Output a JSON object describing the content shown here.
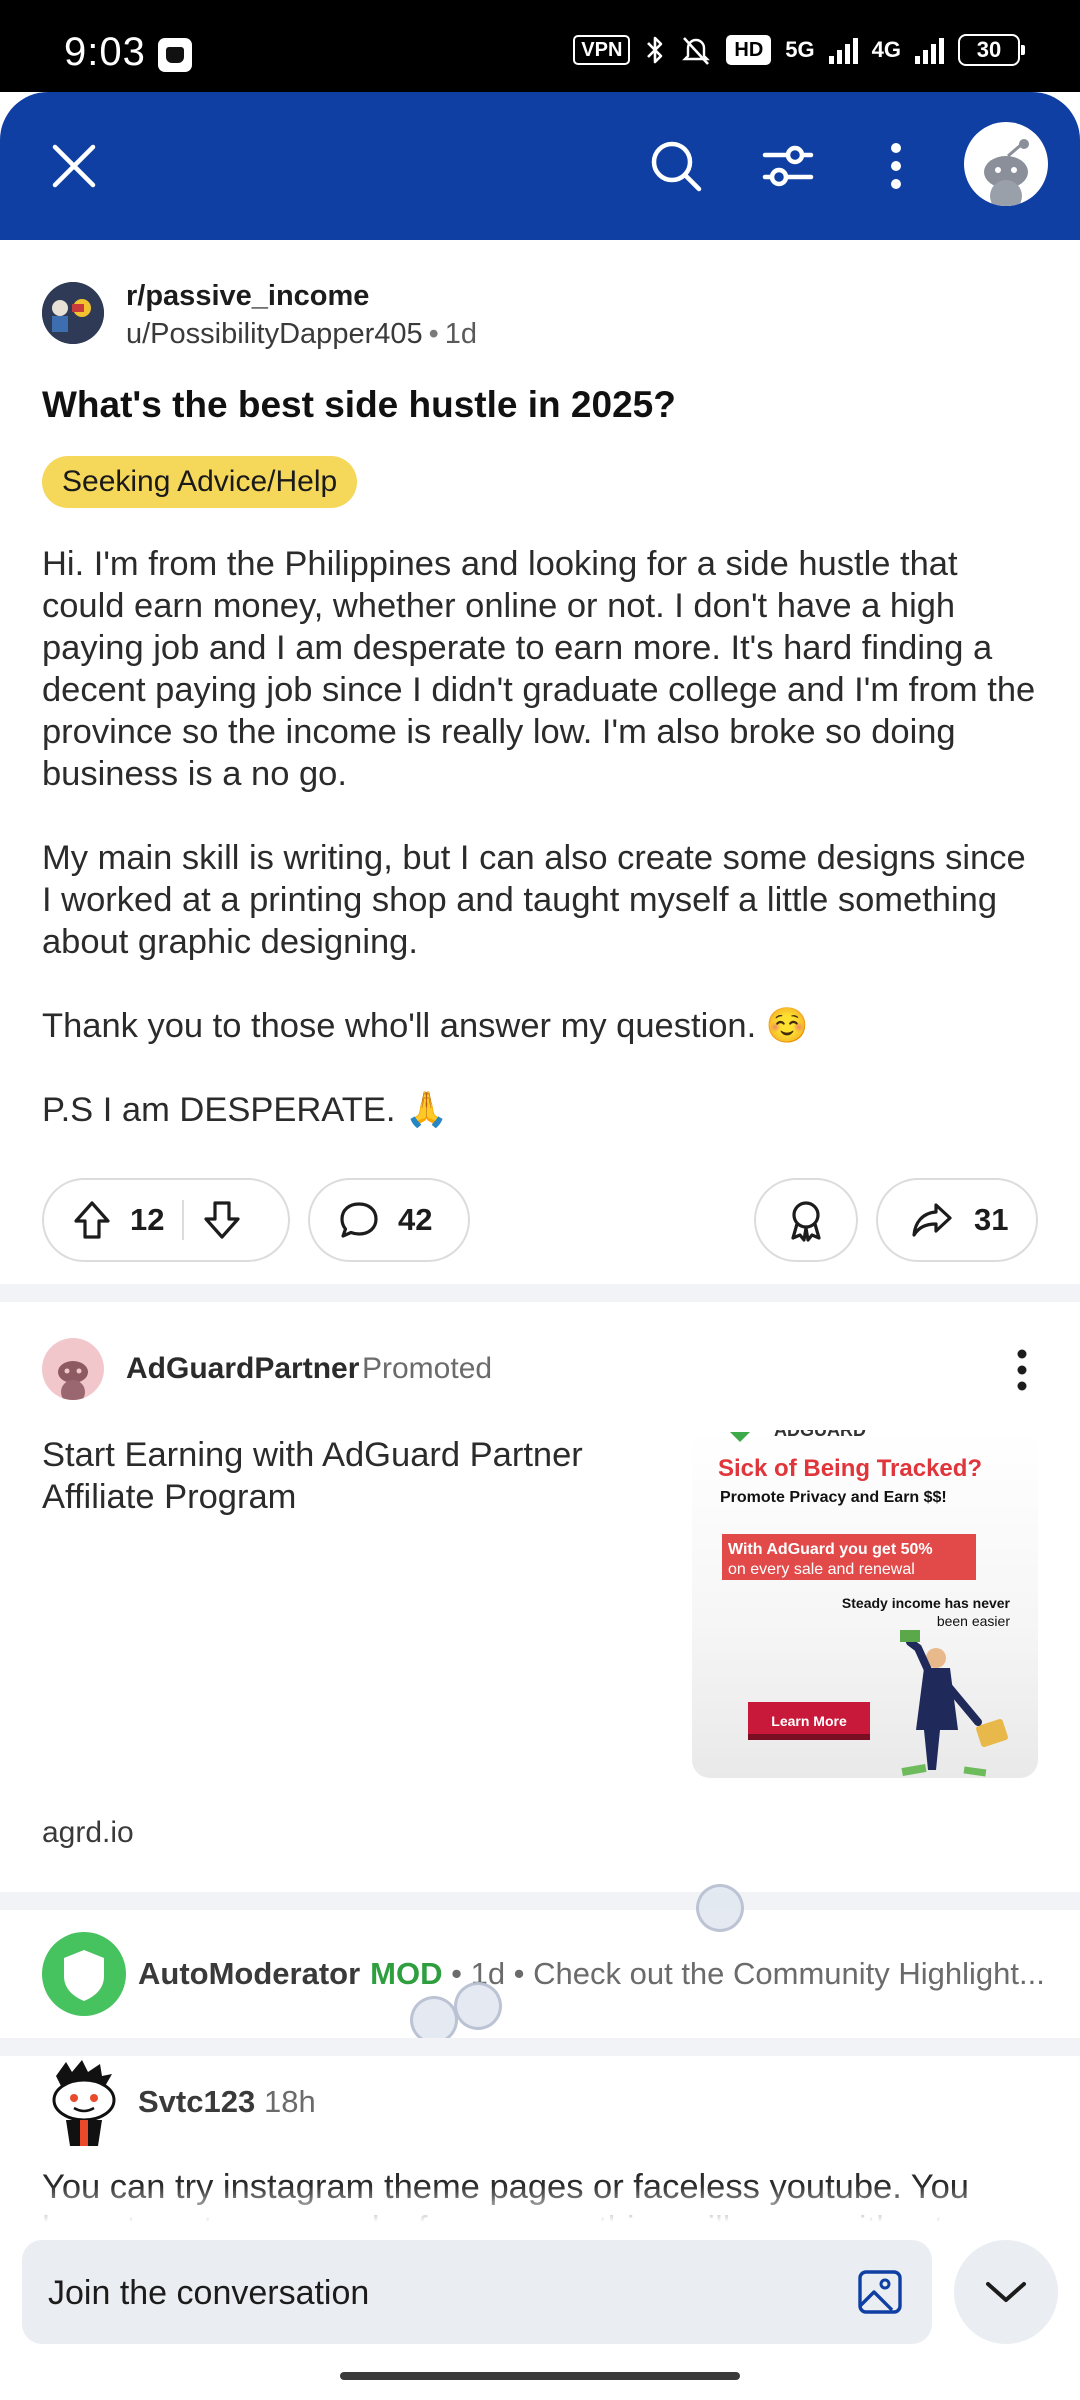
{
  "status_bar": {
    "time": "9:03",
    "vpn": "VPN",
    "hd": "HD",
    "net1": "5G",
    "net2": "4G",
    "battery": "30"
  },
  "header": {
    "close_icon": "close-icon",
    "search_icon": "search-icon",
    "filter_icon": "sort-sliders-icon",
    "more_icon": "more-vertical-icon"
  },
  "post": {
    "subreddit": "r/passive_income",
    "author": "u/PossibilityDapper405",
    "age": "1d",
    "title": "What's the best side hustle in 2025?",
    "flair": "Seeking Advice/Help",
    "paragraphs": [
      "Hi. I'm from the Philippines and looking for a side hustle that could earn money, whether online or not. I don't have a high paying job and I am desperate to earn more. It's hard finding a decent paying job since I didn't graduate college and I'm from the province so the income is really low. I'm also broke so doing business is a no go.",
      "My main skill is writing, but I can also create some designs since I worked at a printing shop and taught myself a little something about graphic designing.",
      "Thank you to those who'll answer my question. ☺️",
      "P.S I am DESPERATE. 🙏"
    ],
    "upvotes": "12",
    "comments": "42",
    "shares": "31"
  },
  "ad": {
    "advertiser": "AdGuardPartner",
    "promoted": "Promoted",
    "title": "Start Earning with AdGuard Partner Affiliate Program",
    "domain": "agrd.io",
    "creative": {
      "brand": "ADGUARD",
      "headline": "Sick of Being Tracked?",
      "subheadline": "Promote Privacy and Earn $$!",
      "offer_line1": "With AdGuard you get 50%",
      "offer_line2": "on every sale and renewal",
      "tagline_line1": "Steady income has never",
      "tagline_line2": "been easier",
      "cta": "Learn More"
    }
  },
  "mod_comment": {
    "author": "AutoModerator",
    "badge": "MOD",
    "meta": "• 1d • Check out the Community Highlight..."
  },
  "comment": {
    "author": "Svtc123",
    "age": "18h",
    "text": "You can try instagram theme pages or faceless youtube. You have to put some work of course, nothing will come without"
  },
  "composer": {
    "placeholder": "Join the conversation"
  },
  "colors": {
    "header_bg": "#0f3fa3",
    "flair_bg": "#f5d75a",
    "mod_green": "#2e9e3f"
  }
}
